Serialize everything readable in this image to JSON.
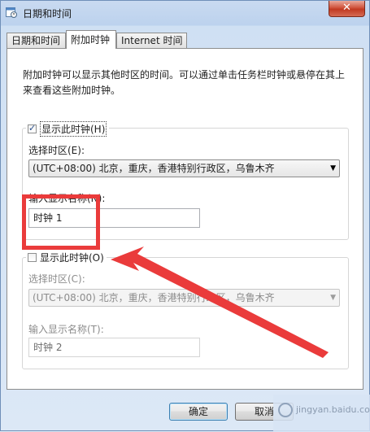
{
  "window": {
    "title": "日期和时间",
    "close_glyph": "✕"
  },
  "tabs": [
    {
      "label": "日期和时间"
    },
    {
      "label": "附加时钟"
    },
    {
      "label": "Internet 时间"
    }
  ],
  "description": "附加时钟可以显示其他时区的时间。可以通过单击任务栏时钟或悬停在其上来查看这些附加时钟。",
  "clock1": {
    "checkbox_label": "显示此时钟(H)",
    "checked": true,
    "timezone_label": "选择时区(E):",
    "timezone_value": "(UTC+08:00) 北京，重庆，香港特别行政区，乌鲁木齐",
    "name_label": "输入显示名称(N):",
    "name_value": "时钟 1"
  },
  "clock2": {
    "checkbox_label": "显示此时钟(O)",
    "checked": false,
    "timezone_label": "选择时区(C):",
    "timezone_value": "(UTC+08:00) 北京，重庆，香港特别行政区，乌鲁木齐",
    "name_label": "输入显示名称(T):",
    "name_value": "时钟 2"
  },
  "buttons": {
    "ok": "确定",
    "cancel": "取消"
  },
  "watermark": {
    "text": "jingyan.baidu.com"
  },
  "colors": {
    "annotation": "#ea3b3b",
    "close": "#c13a22"
  },
  "icons": {
    "window_icon": "calendar-clock-icon",
    "dropdown": "chevron-down-icon"
  }
}
